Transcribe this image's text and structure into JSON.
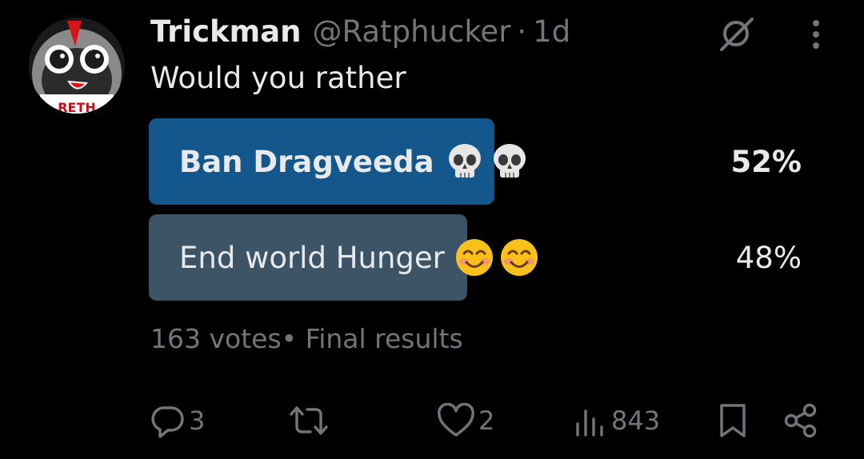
{
  "tweet": {
    "display_name": "Trickman",
    "handle": "@Ratphucker",
    "separator": "·",
    "time": "1d",
    "text": "Would you rather",
    "avatar_text": "RETH"
  },
  "poll": {
    "options": [
      {
        "label": "Ban Dragveeda",
        "emoji": [
          "skull",
          "skull"
        ],
        "percent": "52%",
        "fraction": 0.52,
        "winner": true
      },
      {
        "label": "End world Hunger",
        "emoji": [
          "smiling-face",
          "smiling-face"
        ],
        "percent": "48%",
        "fraction": 0.48,
        "winner": false
      }
    ],
    "votes": "163 votes",
    "status": "Final results"
  },
  "actions": {
    "replies": "3",
    "reposts": "",
    "likes": "2",
    "views": "843"
  },
  "icons": {
    "reply": "reply-icon",
    "repost": "repost-icon",
    "like": "heart-icon",
    "views": "views-icon",
    "bookmark": "bookmark-icon",
    "share": "share-icon",
    "grok": "grok-icon",
    "more": "more-icon"
  },
  "colors": {
    "background": "#000000",
    "text": "#e7e9ea",
    "muted": "#71767b",
    "winner_bar": "#14578c",
    "loser_bar": "#3d5466"
  }
}
